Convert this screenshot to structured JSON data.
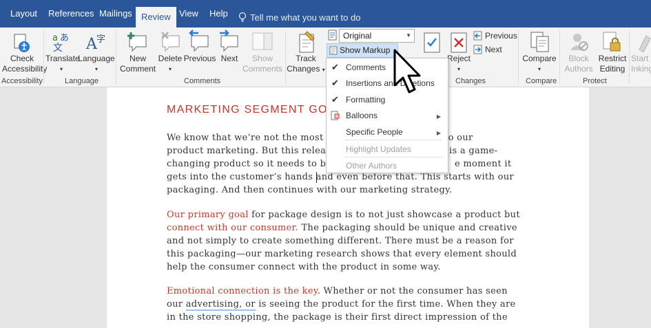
{
  "tabs": [
    "Layout",
    "References",
    "Mailings",
    "Review",
    "View",
    "Help"
  ],
  "active_tab": "Review",
  "tell_me": "Tell me what you want to do",
  "ribbon": {
    "check_accessibility": [
      "Check",
      "Accessibility"
    ],
    "translate": "Translate",
    "language": "Language",
    "new_comment": [
      "New",
      "Comment"
    ],
    "delete": "Delete",
    "previous": "Previous",
    "next": "Next",
    "show_comments": [
      "Show",
      "Comments"
    ],
    "track_changes": [
      "Track",
      "Changes"
    ],
    "markup_value": "Original",
    "show_markup": "Show Markup",
    "accept": "Accept",
    "reject": "Reject",
    "prev_change": "Previous",
    "next_change": "Next",
    "compare": "Compare",
    "block_authors": [
      "Block",
      "Authors"
    ],
    "restrict_editing": [
      "Restrict",
      "Editing"
    ],
    "start_inking": [
      "Start",
      "Inking"
    ],
    "groups": {
      "accessibility": "Accessibility",
      "language": "Language",
      "comments": "Comments",
      "changes": "Changes",
      "compare": "Compare",
      "protect": "Protect"
    }
  },
  "markup_menu": {
    "items": [
      {
        "label": "Comments",
        "checked": true,
        "disabled": false
      },
      {
        "label": "Insertions and Deletions",
        "checked": true,
        "disabled": false
      },
      {
        "label": "Formatting",
        "checked": true,
        "disabled": false
      },
      {
        "label": "Balloons",
        "checked": false,
        "disabled": false,
        "submenu": true
      },
      {
        "label": "Specific People",
        "checked": false,
        "disabled": false,
        "submenu": true
      },
      {
        "label": "Highlight Updates",
        "checked": false,
        "disabled": true
      },
      {
        "label": "Other Authors",
        "checked": false,
        "disabled": true
      }
    ]
  },
  "document": {
    "title": "MARKETING SEGMENT GOAL",
    "p1": [
      "We know that we’re not the most",
      "nes to our",
      "product marketing. But this relea",
      "is a game-",
      "changing product so it needs to b",
      "e moment it",
      "gets into the customer’s hands and even before that. This starts with our",
      "packaging. And then continues with our marketing strategy."
    ],
    "p2_lead": "Our primary goal",
    "p2_rest1": " for package design is to not just showcase a product but",
    "p2_red2": "connect with our consumer.",
    "p2_rest2": " The packaging should be unique and creative",
    "p2_lines": [
      "and not simply to create something different. There must be a reason for",
      "this packaging—our marketing research shows that every element should",
      "help the consumer connect with the product in some way."
    ],
    "p3_lead": "Emotional connection is the key",
    "p3_rest1": ". Whether or not the consumer has seen",
    "p3_l2a": "our ",
    "p3_l2u": "advertising, or",
    "p3_l2b": " is seeing the product for the first time. When they are",
    "p3_l3": "in the store shopping, the package is their first direct impression of the"
  }
}
